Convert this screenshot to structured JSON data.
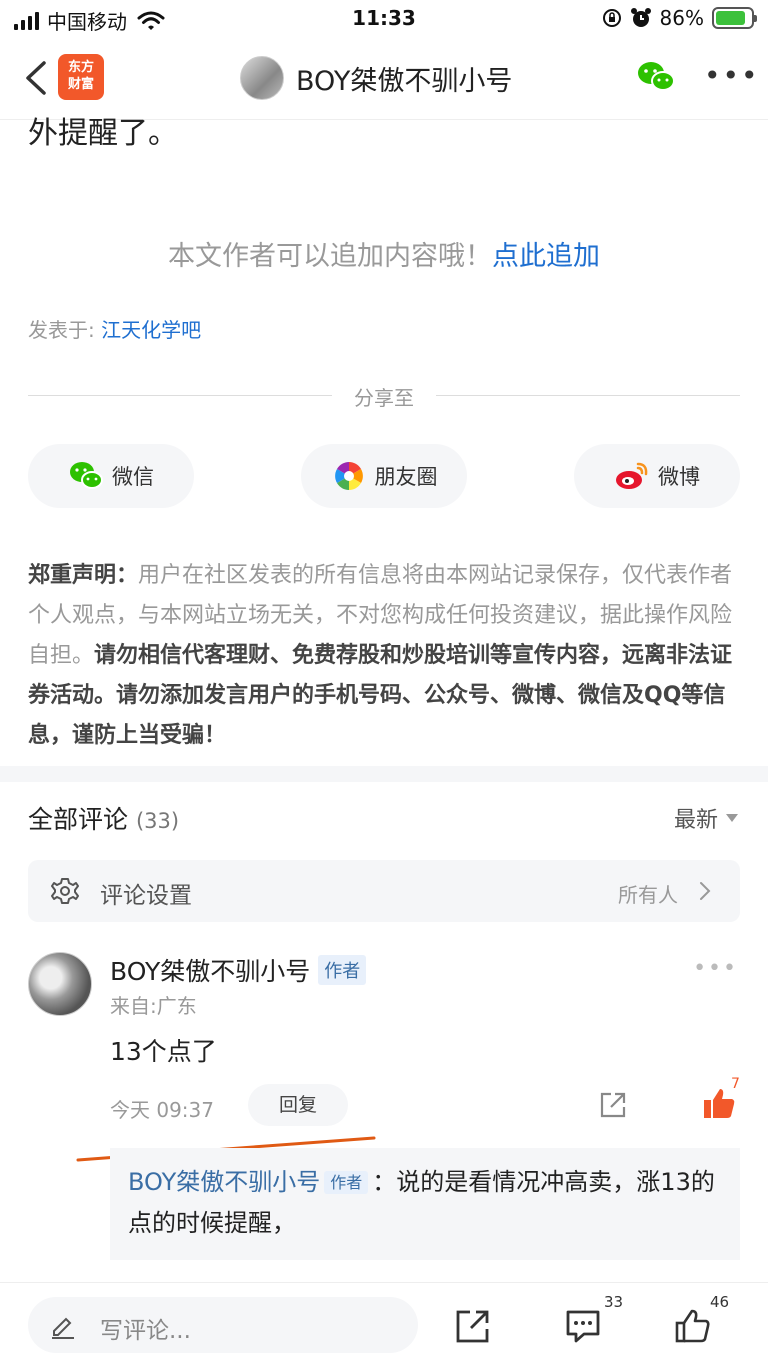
{
  "status_bar": {
    "carrier": "中国移动",
    "time": "11:33",
    "battery": "86%"
  },
  "nav": {
    "logo_line1": "东方",
    "logo_line2": "财富",
    "title": "BOY桀傲不驯小号"
  },
  "article": {
    "tail_text": "外提醒了。",
    "append_hint": "本文作者可以追加内容哦！",
    "append_link": "点此追加",
    "posted_label": "发表于:",
    "posted_bar": "江天化学吧"
  },
  "share": {
    "label": "分享至",
    "buttons": [
      {
        "label": "微信",
        "icon": "wechat-icon"
      },
      {
        "label": "朋友圈",
        "icon": "moments-icon"
      },
      {
        "label": "微博",
        "icon": "weibo-icon"
      }
    ]
  },
  "disclaimer": {
    "title": "郑重声明：",
    "text1": "用户在社区发表的所有信息将由本网站记录保存，仅代表作者个人观点，与本网站立场无关，不对您构成任何投资建议，据此操作风险自担。",
    "text2": "请勿相信代客理财、免费荐股和炒股培训等宣传内容，远离非法证券活动。请勿添加发言用户的手机号码、公众号、微博、微信及QQ等信息，谨防上当受骗！"
  },
  "comments": {
    "title": "全部评论",
    "count": "(33)",
    "sort": "最新",
    "setting_label": "评论设置",
    "setting_value": "所有人",
    "items": [
      {
        "author": "BOY桀傲不驯小号",
        "author_tag": "作者",
        "from": "来自:广东",
        "text": "13个点了",
        "time": "今天 09:37",
        "reply_label": "回复",
        "likes": "7",
        "sub_reply": {
          "author": "BOY桀傲不驯小号",
          "author_tag": "作者",
          "text": "：说的是看情况冲高卖，涨13的点的时候提醒，"
        }
      }
    ]
  },
  "bottom": {
    "input_placeholder": "写评论...",
    "comment_count": "33",
    "like_count": "46"
  },
  "colors": {
    "brand": "#f2582a",
    "link": "#1f6fd0",
    "author_name": "#3a6ea5"
  }
}
